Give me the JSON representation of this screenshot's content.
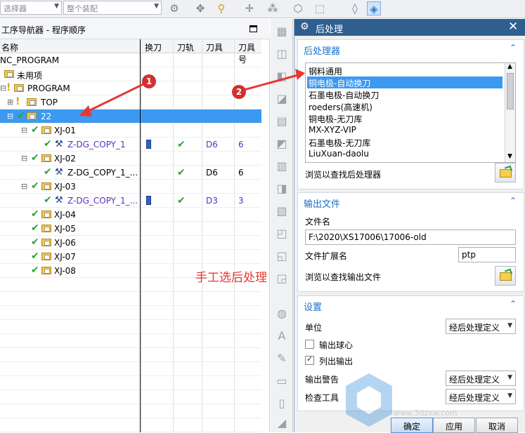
{
  "toolbar": {
    "combo1": "选择器",
    "combo2": "整个装配"
  },
  "navigator": {
    "title": "工序导航器 - 程序顺序",
    "columns": [
      "名称",
      "换刀",
      "刀轨",
      "刀具",
      "刀具号"
    ],
    "rows": [
      {
        "label": "NC_PROGRAM"
      },
      {
        "label": "未用项"
      },
      {
        "label": "PROGRAM"
      },
      {
        "label": "TOP"
      },
      {
        "label": "22"
      },
      {
        "label": "XJ-01"
      },
      {
        "label": "Z-DG_COPY_1",
        "tool": "D6",
        "num": "6"
      },
      {
        "label": "XJ-02"
      },
      {
        "label": "Z-DG_COPY_1_...",
        "tool": "D6",
        "num": "6"
      },
      {
        "label": "XJ-03"
      },
      {
        "label": "Z-DG_COPY_1_...",
        "tool": "D3",
        "num": "3"
      },
      {
        "label": "XJ-04"
      },
      {
        "label": "XJ-05"
      },
      {
        "label": "XJ-06"
      },
      {
        "label": "XJ-07"
      },
      {
        "label": "XJ-08"
      }
    ]
  },
  "dialog": {
    "title": "后处理",
    "postprocessor": {
      "heading": "后处理器",
      "items": [
        "钢料通用",
        "铜电极-自动换刀",
        "石墨电极-自动换刀",
        "roeders(高速机)",
        "铜电极-无刀库",
        "MX-XYZ-VIP",
        "石墨电极-无刀库",
        "LiuXuan-daolu"
      ],
      "selected_index": 1,
      "browse_label": "浏览以查找后处理器"
    },
    "output": {
      "heading": "输出文件",
      "filename_label": "文件名",
      "filename_value": "F:\\2020\\XS17006\\17006-old",
      "ext_label": "文件扩展名",
      "ext_value": "ptp",
      "browse_label": "浏览以查找输出文件"
    },
    "settings": {
      "heading": "设置",
      "units_label": "单位",
      "units_value": "经后处理定义",
      "output_ball_label": "输出球心",
      "list_output_label": "列出输出",
      "warnings_label": "输出警告",
      "warnings_value": "经后处理定义",
      "check_label": "检查工具",
      "check_value": "经后处理定义"
    },
    "buttons": {
      "ok": "确定",
      "apply": "应用",
      "cancel": "取消"
    }
  },
  "annotations": {
    "note": "手工选后处理",
    "badge1": "1",
    "badge2": "2"
  },
  "watermark_text": "www.3dzxw.com",
  "colors": {
    "accent": "#3c99f0",
    "dialog_title": "#2f5f8f",
    "annotation": "#e53935"
  }
}
